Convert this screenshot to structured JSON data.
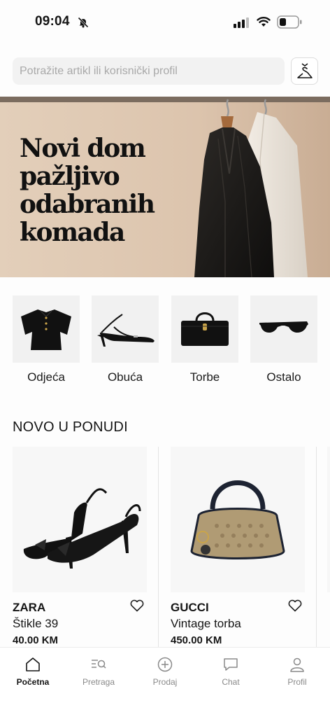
{
  "status_bar": {
    "time": "09:04"
  },
  "search": {
    "placeholder": "Potražite artikl ili korisnički profil"
  },
  "hero": {
    "title": "Novi dom pažljivo odabranih komada"
  },
  "categories": [
    {
      "label": "Odjeća",
      "icon": "shirt-icon"
    },
    {
      "label": "Obuća",
      "icon": "heel-shoe-icon"
    },
    {
      "label": "Torbe",
      "icon": "handbag-icon"
    },
    {
      "label": "Ostalo",
      "icon": "sunglasses-icon"
    }
  ],
  "section": {
    "title": "NOVO U PONUDI"
  },
  "products": [
    {
      "brand": "ZARA",
      "name": "Štikle  39",
      "price": "40.00 KM"
    },
    {
      "brand": "GUCCI",
      "name": "Vintage torba",
      "price": "450.00 KM"
    }
  ],
  "tab_bar": [
    {
      "label": "Početna",
      "icon": "home-icon",
      "active": true
    },
    {
      "label": "Pretraga",
      "icon": "search-list-icon",
      "active": false
    },
    {
      "label": "Prodaj",
      "icon": "plus-circle-icon",
      "active": false
    },
    {
      "label": "Chat",
      "icon": "chat-icon",
      "active": false
    },
    {
      "label": "Profil",
      "icon": "user-icon",
      "active": false
    }
  ],
  "colors": {
    "hero_background": "#dfcab5",
    "text": "#151515",
    "inactive_tab": "#8a8a8a"
  }
}
